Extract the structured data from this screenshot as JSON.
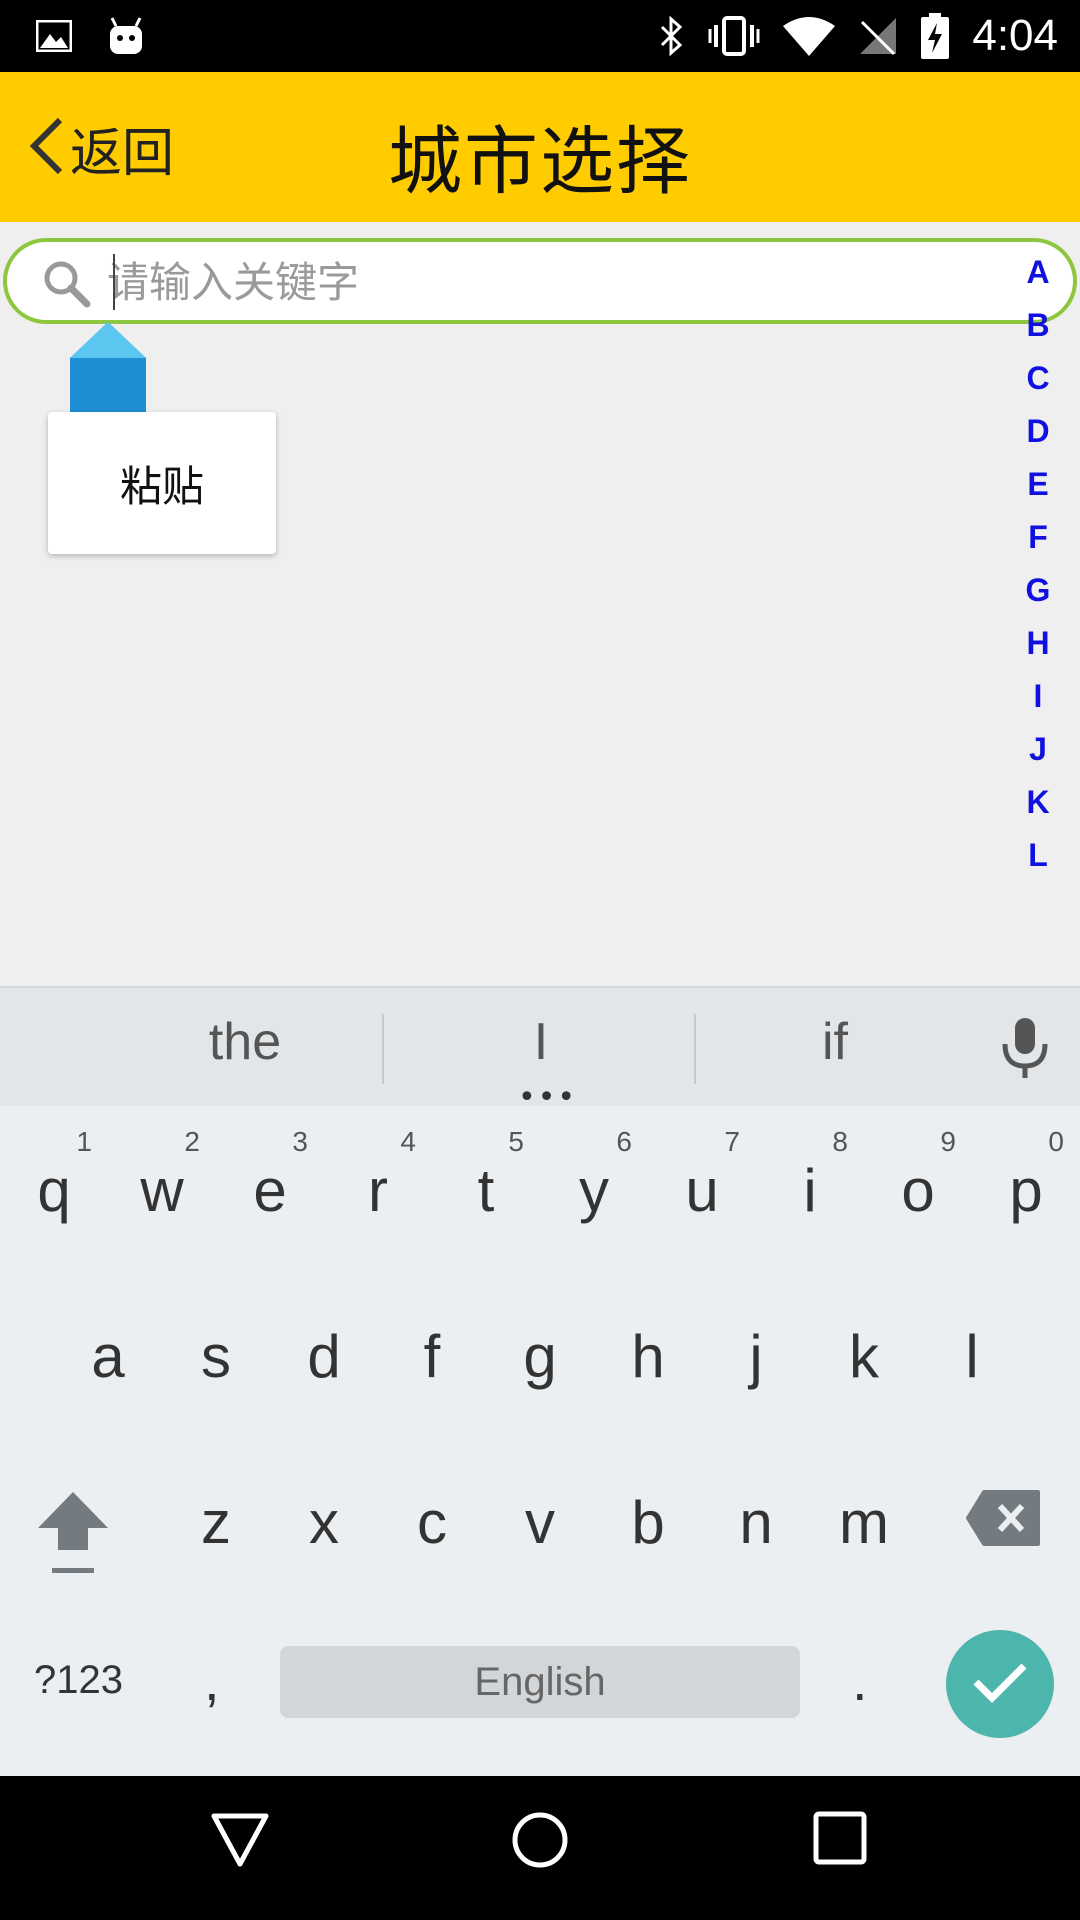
{
  "status_bar": {
    "time": "4:04",
    "left_icons": [
      "image-icon",
      "android-icon"
    ],
    "right_icons": [
      "bluetooth-icon",
      "vibrate-icon",
      "wifi-icon",
      "no-sim-icon",
      "battery-charging-icon"
    ]
  },
  "header": {
    "back_label": "返回",
    "title": "城市选择",
    "background": "#FFCC00"
  },
  "search": {
    "placeholder": "请输入关键字",
    "value": "",
    "border_color": "#8DC63F"
  },
  "popup": {
    "paste_label": "粘贴"
  },
  "alpha_index": [
    "A",
    "B",
    "C",
    "D",
    "E",
    "F",
    "G",
    "H",
    "I",
    "J",
    "K",
    "L"
  ],
  "keyboard": {
    "suggestions": [
      "the",
      "I",
      "if"
    ],
    "row1": [
      {
        "key": "q",
        "hint": "1"
      },
      {
        "key": "w",
        "hint": "2"
      },
      {
        "key": "e",
        "hint": "3"
      },
      {
        "key": "r",
        "hint": "4"
      },
      {
        "key": "t",
        "hint": "5"
      },
      {
        "key": "y",
        "hint": "6"
      },
      {
        "key": "u",
        "hint": "7"
      },
      {
        "key": "i",
        "hint": "8"
      },
      {
        "key": "o",
        "hint": "9"
      },
      {
        "key": "p",
        "hint": "0"
      }
    ],
    "row2": [
      "a",
      "s",
      "d",
      "f",
      "g",
      "h",
      "j",
      "k",
      "l"
    ],
    "row3": [
      "z",
      "x",
      "c",
      "v",
      "b",
      "n",
      "m"
    ],
    "symbols_label": "?123",
    "comma_label": ",",
    "space_label": "English",
    "period_label": ".",
    "enter_color": "#4DB6AC"
  },
  "nav": {
    "icons": [
      "back-triangle-icon",
      "home-circle-icon",
      "recents-square-icon"
    ]
  }
}
